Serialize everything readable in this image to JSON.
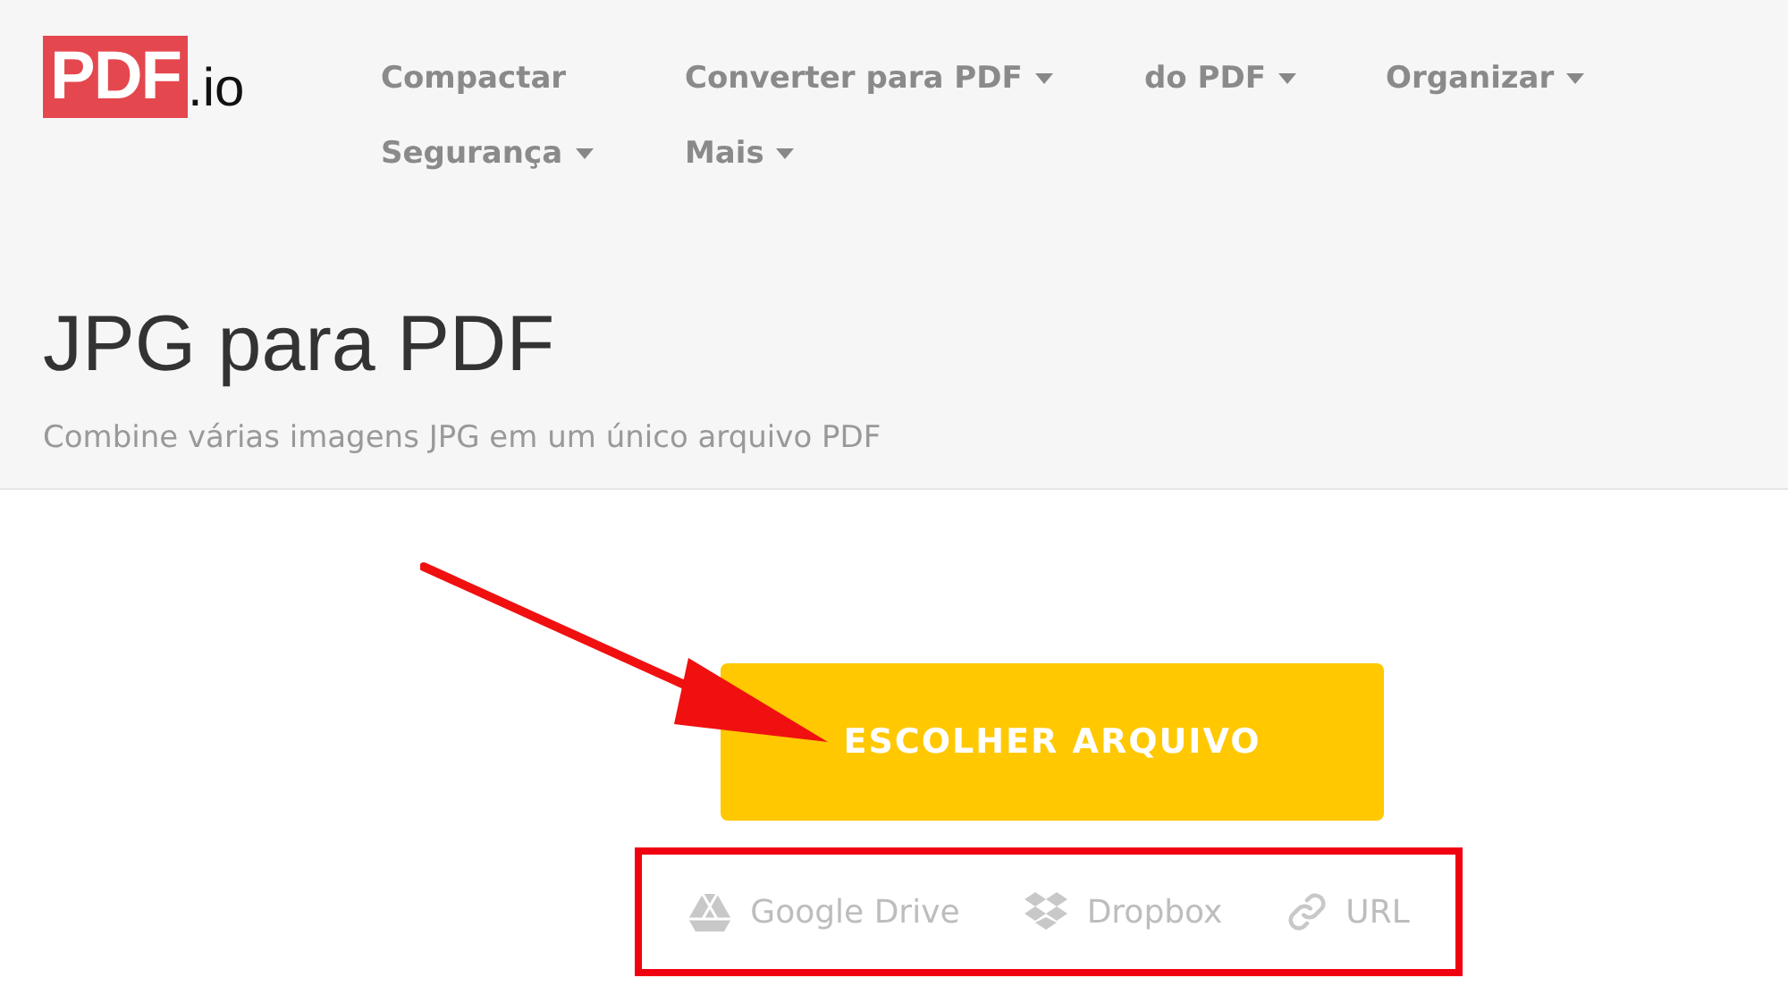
{
  "logo": {
    "mark": "PDF",
    "suffix": ".io"
  },
  "nav": [
    {
      "label": "Compactar",
      "dropdown": false
    },
    {
      "label": "Converter para PDF",
      "dropdown": true
    },
    {
      "label": "do PDF",
      "dropdown": true
    },
    {
      "label": "Organizar",
      "dropdown": true
    },
    {
      "label": "Segurança",
      "dropdown": true
    },
    {
      "label": "Mais",
      "dropdown": true
    }
  ],
  "title": "JPG para PDF",
  "subtitle": "Combine várias imagens JPG em um único arquivo PDF",
  "upload_button": "ESCOLHER ARQUIVO",
  "sources": [
    {
      "kind": "drive",
      "label": "Google Drive"
    },
    {
      "kind": "dropbox",
      "label": "Dropbox"
    },
    {
      "kind": "url",
      "label": "URL"
    }
  ]
}
